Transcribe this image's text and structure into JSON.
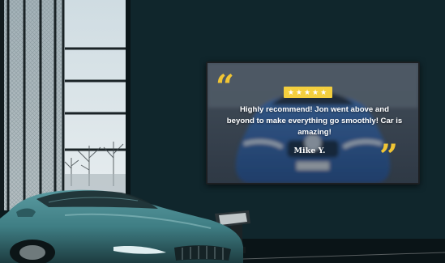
{
  "testimonial": {
    "stars": "★★★★★",
    "rating": 5,
    "text": "Highly recommend! Jon went above and beyond to make everything go smoothly! Car is amazing!",
    "author": "Mike Y.",
    "quote_open": "“",
    "quote_close": "”",
    "accent_color": "#f4cf3e"
  },
  "scene": {
    "wall_color": "#10252b",
    "car_color": "#3f7e84"
  }
}
